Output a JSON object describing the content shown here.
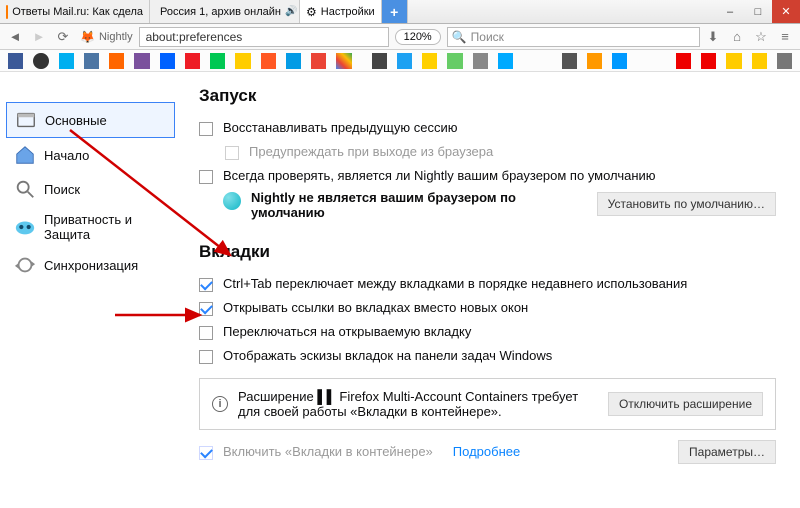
{
  "tabs": [
    {
      "label": "Ответы Mail.ru: Как сдела"
    },
    {
      "label": "Россия 1, архив онлайн"
    },
    {
      "label": "Настройки"
    }
  ],
  "tab_plus": "+",
  "winbtns": {
    "min": "–",
    "max": "□",
    "close": "✕"
  },
  "identity_label": "Nightly",
  "url": "about:preferences",
  "zoom": "120%",
  "search_placeholder": "Поиск",
  "sidebar": {
    "items": [
      {
        "label": "Основные"
      },
      {
        "label": "Начало"
      },
      {
        "label": "Поиск"
      },
      {
        "label": "Приватность и Защита"
      },
      {
        "label": "Синхронизация"
      }
    ]
  },
  "startup": {
    "heading": "Запуск",
    "restore": "Восстанавливать предыдущую сессию",
    "warn": "Предупреждать при выходе из браузера",
    "check_default": "Всегда проверять, является ли Nightly вашим браузером по умолчанию",
    "not_default": "Nightly не является вашим браузером по умолчанию",
    "set_default_btn": "Установить по умолчанию…"
  },
  "tabs_section": {
    "heading": "Вкладки",
    "ctrl_tab": "Ctrl+Tab переключает между вкладками в порядке недавнего использования",
    "open_links": "Открывать ссылки во вкладках вместо новых окон",
    "switch_to": "Переключаться на открываемую вкладку",
    "previews": "Отображать эскизы вкладок на панели задач Windows",
    "ext_msg": "Расширение ▌▌ Firefox Multi-Account Containers требует для своей работы «Вкладки в контейнере».",
    "ext_btn": "Отключить расширение",
    "containers": "Включить «Вкладки в контейнере»",
    "learn_more": "Подробнее",
    "settings_btn": "Параметры…"
  }
}
